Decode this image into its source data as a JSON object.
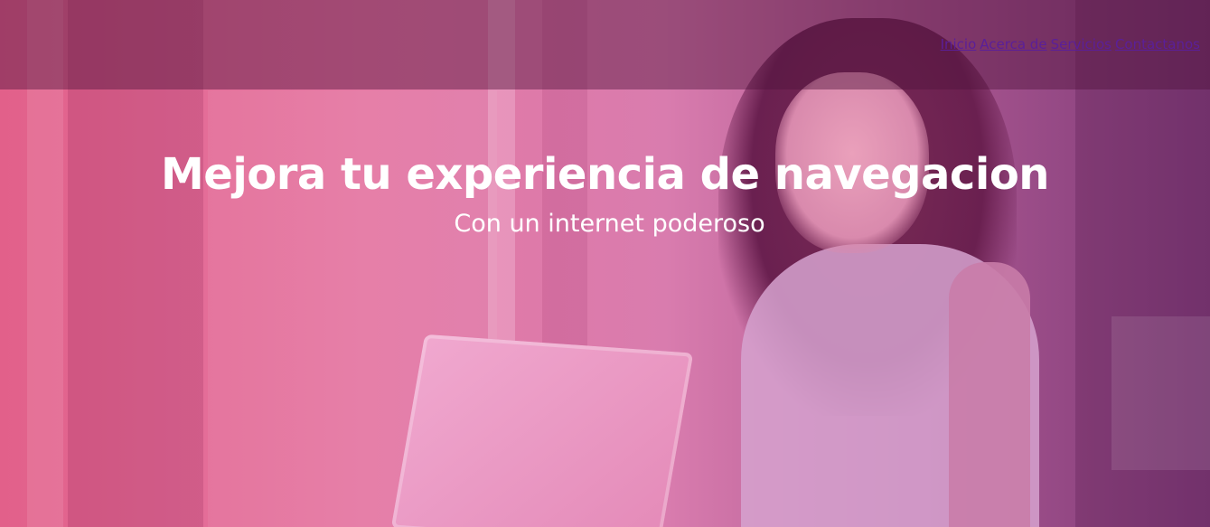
{
  "nav": {
    "items": [
      {
        "label": "Inicio"
      },
      {
        "label": "Acerca de"
      },
      {
        "label": "Servicios"
      },
      {
        "label": "Contactanos"
      }
    ]
  },
  "hero": {
    "title": "Mejora tu experiencia de navegacion",
    "subtitle": "Con un internet poderoso",
    "background_image": "woman-with-laptop-photo",
    "overlay_colors": {
      "left": "#e2608a",
      "right": "#7d3a78"
    }
  },
  "colors": {
    "link": "#5a1f9a",
    "topbar": "#50143c",
    "text": "#ffffff"
  }
}
